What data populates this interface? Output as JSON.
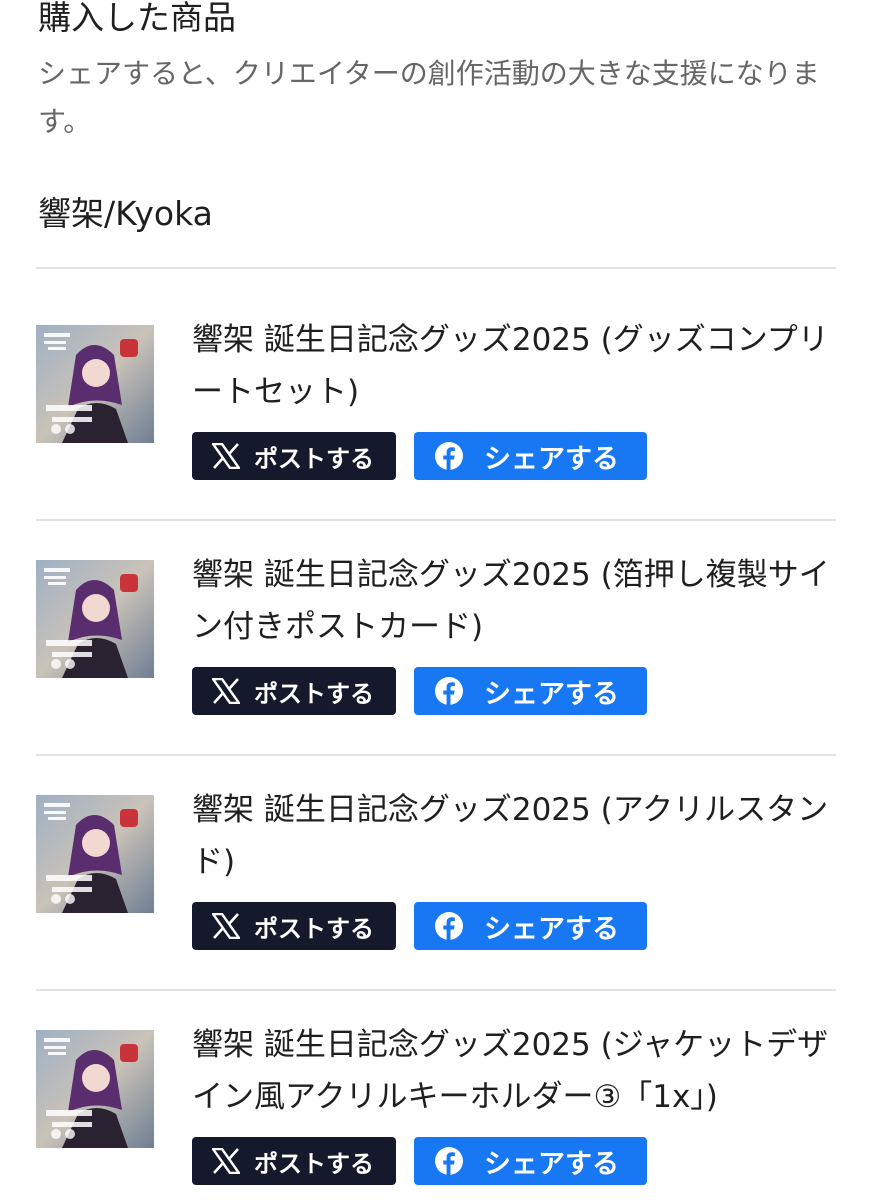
{
  "header": {
    "title": "購入した商品",
    "description": "シェアすると、クリエイターの創作活動の大きな支援になります。"
  },
  "shop": {
    "name": "響架/Kyoka"
  },
  "items": [
    {
      "title": "響架 誕生日記念グッズ2025 (グッズコンプリートセット)",
      "post_label": "ポストする",
      "share_label": "シェアする"
    },
    {
      "title": "響架 誕生日記念グッズ2025 (箔押し複製サイン付きポストカード)",
      "post_label": "ポストする",
      "share_label": "シェアする"
    },
    {
      "title": "響架 誕生日記念グッズ2025 (アクリルスタンド)",
      "post_label": "ポストする",
      "share_label": "シェアする"
    },
    {
      "title": "響架 誕生日記念グッズ2025 (ジャケットデザイン風アクリルキーホルダー③「1x」)",
      "post_label": "ポストする",
      "share_label": "シェアする"
    }
  ],
  "icons": {
    "post_button_icon": "x-logo-icon",
    "share_button_icon": "facebook-icon",
    "thumbnail": "product-thumbnail"
  },
  "colors": {
    "post_button_bg": "#141a2b",
    "share_button_bg": "#1877f2",
    "divider": "#e3e3e3",
    "description_text": "#666666"
  }
}
